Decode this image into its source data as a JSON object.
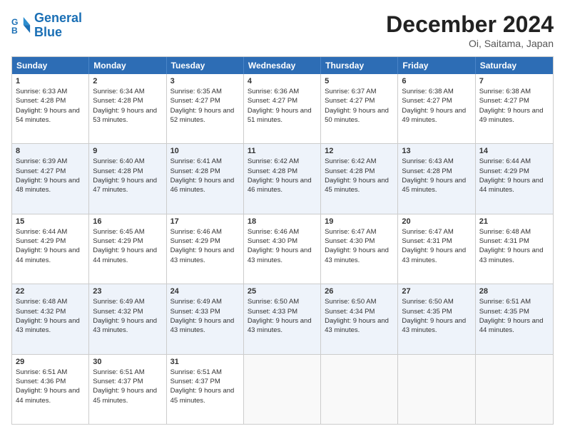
{
  "header": {
    "logo_line1": "General",
    "logo_line2": "Blue",
    "month_title": "December 2024",
    "location": "Oi, Saitama, Japan"
  },
  "days_of_week": [
    "Sunday",
    "Monday",
    "Tuesday",
    "Wednesday",
    "Thursday",
    "Friday",
    "Saturday"
  ],
  "weeks": [
    [
      {
        "day": "1",
        "sunrise": "6:33 AM",
        "sunset": "4:28 PM",
        "daylight": "9 hours and 54 minutes."
      },
      {
        "day": "2",
        "sunrise": "6:34 AM",
        "sunset": "4:28 PM",
        "daylight": "9 hours and 53 minutes."
      },
      {
        "day": "3",
        "sunrise": "6:35 AM",
        "sunset": "4:27 PM",
        "daylight": "9 hours and 52 minutes."
      },
      {
        "day": "4",
        "sunrise": "6:36 AM",
        "sunset": "4:27 PM",
        "daylight": "9 hours and 51 minutes."
      },
      {
        "day": "5",
        "sunrise": "6:37 AM",
        "sunset": "4:27 PM",
        "daylight": "9 hours and 50 minutes."
      },
      {
        "day": "6",
        "sunrise": "6:38 AM",
        "sunset": "4:27 PM",
        "daylight": "9 hours and 49 minutes."
      },
      {
        "day": "7",
        "sunrise": "6:38 AM",
        "sunset": "4:27 PM",
        "daylight": "9 hours and 49 minutes."
      }
    ],
    [
      {
        "day": "8",
        "sunrise": "6:39 AM",
        "sunset": "4:27 PM",
        "daylight": "9 hours and 48 minutes."
      },
      {
        "day": "9",
        "sunrise": "6:40 AM",
        "sunset": "4:28 PM",
        "daylight": "9 hours and 47 minutes."
      },
      {
        "day": "10",
        "sunrise": "6:41 AM",
        "sunset": "4:28 PM",
        "daylight": "9 hours and 46 minutes."
      },
      {
        "day": "11",
        "sunrise": "6:42 AM",
        "sunset": "4:28 PM",
        "daylight": "9 hours and 46 minutes."
      },
      {
        "day": "12",
        "sunrise": "6:42 AM",
        "sunset": "4:28 PM",
        "daylight": "9 hours and 45 minutes."
      },
      {
        "day": "13",
        "sunrise": "6:43 AM",
        "sunset": "4:28 PM",
        "daylight": "9 hours and 45 minutes."
      },
      {
        "day": "14",
        "sunrise": "6:44 AM",
        "sunset": "4:29 PM",
        "daylight": "9 hours and 44 minutes."
      }
    ],
    [
      {
        "day": "15",
        "sunrise": "6:44 AM",
        "sunset": "4:29 PM",
        "daylight": "9 hours and 44 minutes."
      },
      {
        "day": "16",
        "sunrise": "6:45 AM",
        "sunset": "4:29 PM",
        "daylight": "9 hours and 44 minutes."
      },
      {
        "day": "17",
        "sunrise": "6:46 AM",
        "sunset": "4:29 PM",
        "daylight": "9 hours and 43 minutes."
      },
      {
        "day": "18",
        "sunrise": "6:46 AM",
        "sunset": "4:30 PM",
        "daylight": "9 hours and 43 minutes."
      },
      {
        "day": "19",
        "sunrise": "6:47 AM",
        "sunset": "4:30 PM",
        "daylight": "9 hours and 43 minutes."
      },
      {
        "day": "20",
        "sunrise": "6:47 AM",
        "sunset": "4:31 PM",
        "daylight": "9 hours and 43 minutes."
      },
      {
        "day": "21",
        "sunrise": "6:48 AM",
        "sunset": "4:31 PM",
        "daylight": "9 hours and 43 minutes."
      }
    ],
    [
      {
        "day": "22",
        "sunrise": "6:48 AM",
        "sunset": "4:32 PM",
        "daylight": "9 hours and 43 minutes."
      },
      {
        "day": "23",
        "sunrise": "6:49 AM",
        "sunset": "4:32 PM",
        "daylight": "9 hours and 43 minutes."
      },
      {
        "day": "24",
        "sunrise": "6:49 AM",
        "sunset": "4:33 PM",
        "daylight": "9 hours and 43 minutes."
      },
      {
        "day": "25",
        "sunrise": "6:50 AM",
        "sunset": "4:33 PM",
        "daylight": "9 hours and 43 minutes."
      },
      {
        "day": "26",
        "sunrise": "6:50 AM",
        "sunset": "4:34 PM",
        "daylight": "9 hours and 43 minutes."
      },
      {
        "day": "27",
        "sunrise": "6:50 AM",
        "sunset": "4:35 PM",
        "daylight": "9 hours and 43 minutes."
      },
      {
        "day": "28",
        "sunrise": "6:51 AM",
        "sunset": "4:35 PM",
        "daylight": "9 hours and 44 minutes."
      }
    ],
    [
      {
        "day": "29",
        "sunrise": "6:51 AM",
        "sunset": "4:36 PM",
        "daylight": "9 hours and 44 minutes."
      },
      {
        "day": "30",
        "sunrise": "6:51 AM",
        "sunset": "4:37 PM",
        "daylight": "9 hours and 45 minutes."
      },
      {
        "day": "31",
        "sunrise": "6:51 AM",
        "sunset": "4:37 PM",
        "daylight": "9 hours and 45 minutes."
      },
      null,
      null,
      null,
      null
    ]
  ]
}
